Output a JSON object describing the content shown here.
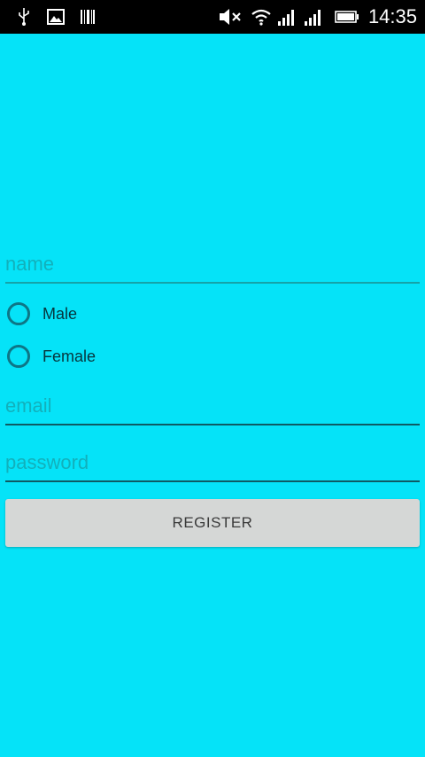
{
  "status_bar": {
    "time": "14:35",
    "icons": [
      "usb-icon",
      "image-icon",
      "barcode-icon",
      "mute-icon",
      "wifi-icon",
      "signal-icon",
      "signal-icon",
      "battery-icon"
    ]
  },
  "form": {
    "name_placeholder": "name",
    "gender_options": [
      {
        "label": "Male",
        "checked": false
      },
      {
        "label": "Female",
        "checked": false
      }
    ],
    "email_placeholder": "email",
    "password_placeholder": "password",
    "register_label": "REGISTER"
  },
  "colors": {
    "background": "#05e3f8",
    "status_bar": "#000000",
    "button": "#d5d7d6",
    "accent": "#0e7686"
  }
}
